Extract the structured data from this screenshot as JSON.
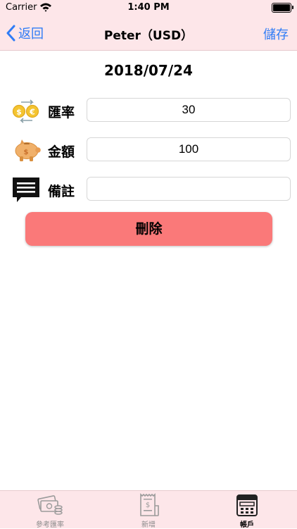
{
  "status_bar": {
    "carrier": "Carrier",
    "time": "1:40 PM"
  },
  "nav": {
    "back_label": "返回",
    "title": "Peter（USD）",
    "save_label": "儲存"
  },
  "date": "2018/07/24",
  "form": {
    "rate": {
      "label": "匯率",
      "value": "30",
      "icon": "currency-exchange-icon"
    },
    "amount": {
      "label": "金額",
      "value": "100",
      "icon": "piggy-bank-icon"
    },
    "note": {
      "label": "備註",
      "value": "",
      "icon": "note-bubble-icon"
    }
  },
  "delete_label": "刪除",
  "tabs": [
    {
      "label": "參考匯率",
      "icon": "money-icon"
    },
    {
      "label": "新增",
      "icon": "receipt-icon"
    },
    {
      "label": "帳戶",
      "icon": "ledger-icon",
      "active": true
    }
  ],
  "colors": {
    "bar_background": "#fde6e9",
    "link_blue": "#2f7cf6",
    "delete_button": "#fa7979"
  }
}
